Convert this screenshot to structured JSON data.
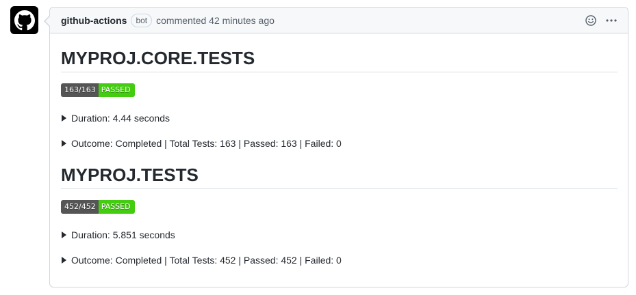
{
  "comment": {
    "author": "github-actions",
    "author_badge": "bot",
    "meta": "commented 42 minutes ago"
  },
  "sections": [
    {
      "title": "MYPROJ.CORE.TESTS",
      "badge_count": "163/163",
      "badge_status": "PASSED",
      "duration": "Duration: 4.44 seconds",
      "outcome": "Outcome: Completed | Total Tests: 163 | Passed: 163 | Failed: 0"
    },
    {
      "title": "MYPROJ.TESTS",
      "badge_count": "452/452",
      "badge_status": "PASSED",
      "duration": "Duration: 5.851 seconds",
      "outcome": "Outcome: Completed | Total Tests: 452 | Passed: 452 | Failed: 0"
    }
  ],
  "icons": {
    "avatar": "github-logo-icon",
    "reaction": "smiley-icon",
    "menu": "kebab-horizontal-icon"
  },
  "colors": {
    "badge_count_bg": "#555555",
    "badge_passed_bg": "#44cc11",
    "header_bg": "#f6f8fa",
    "border": "#d0d7de"
  }
}
